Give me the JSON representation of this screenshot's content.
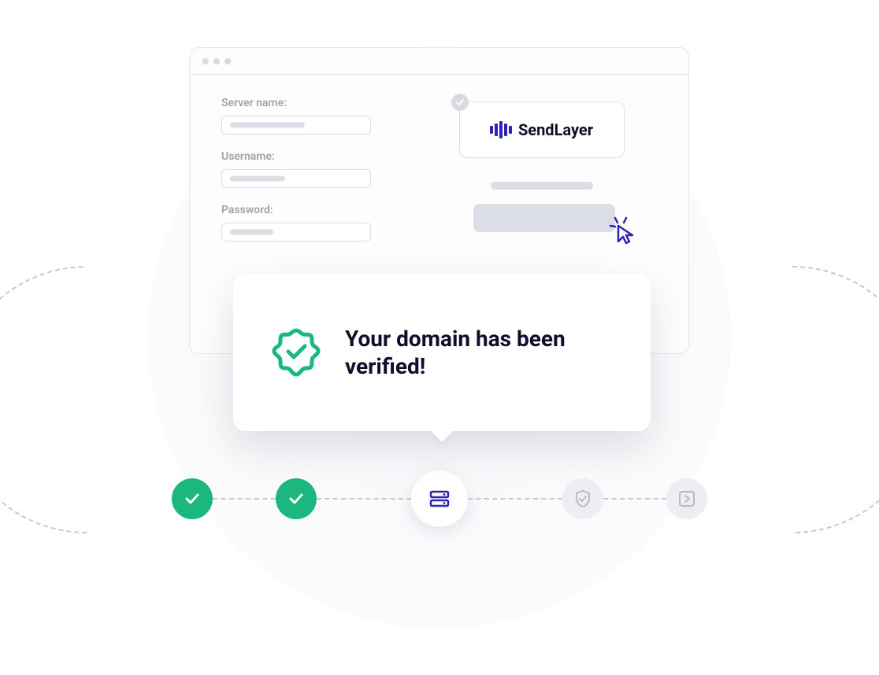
{
  "form": {
    "server_label": "Server name:",
    "username_label": "Username:",
    "password_label": "Password:"
  },
  "brand": {
    "name": "SendLayer"
  },
  "tooltip": {
    "message": "Your domain has been verified!"
  },
  "colors": {
    "accent": "#2f22b5",
    "success": "#1bb77e",
    "muted": "#dcdee5",
    "text": "#0e0e2c"
  },
  "steps": {
    "count": 5,
    "completed": [
      1,
      2
    ],
    "current": 3
  }
}
